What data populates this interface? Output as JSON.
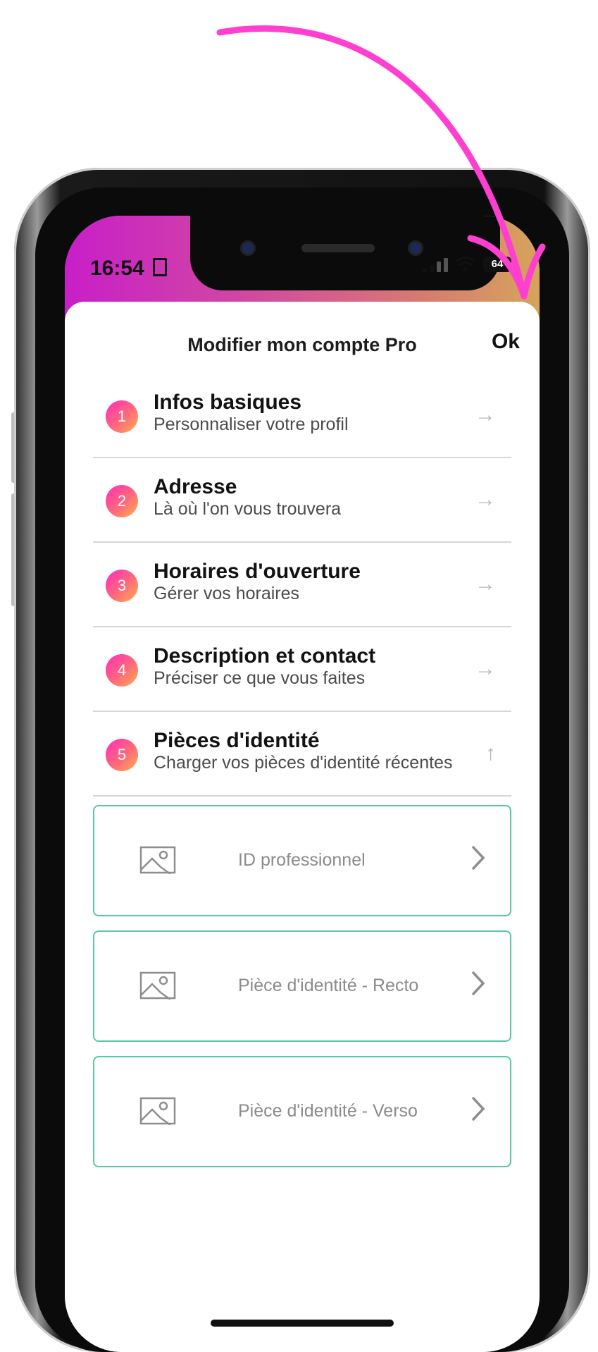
{
  "status_bar": {
    "time": "16:54",
    "battery": "64"
  },
  "header": {
    "title": "Modifier mon compte Pro",
    "ok_label": "Ok"
  },
  "steps": [
    {
      "number": "1",
      "title": "Infos basiques",
      "subtitle": "Personnaliser votre profil",
      "arrow": "→"
    },
    {
      "number": "2",
      "title": "Adresse",
      "subtitle": "Là où l'on vous trouvera",
      "arrow": "→"
    },
    {
      "number": "3",
      "title": "Horaires d'ouverture",
      "subtitle": "Gérer vos horaires",
      "arrow": "→"
    },
    {
      "number": "4",
      "title": "Description et contact",
      "subtitle": "Préciser ce que vous faites",
      "arrow": "→"
    },
    {
      "number": "5",
      "title": "Pièces d'identité",
      "subtitle": "Charger vos pièces d'identité récentes",
      "arrow": "↑"
    }
  ],
  "documents": [
    {
      "label": "ID professionnel",
      "icon": "image-icon"
    },
    {
      "label": "Pièce d'identité - Recto",
      "icon": "image-icon"
    },
    {
      "label": "Pièce d'identité - Verso",
      "icon": "image-icon"
    }
  ],
  "colors": {
    "accent_gradient_start": "#c81ec9",
    "accent_gradient_end": "#d6a45a",
    "card_border": "#58c9a1",
    "annotation_arrow": "#ff3fd0"
  }
}
